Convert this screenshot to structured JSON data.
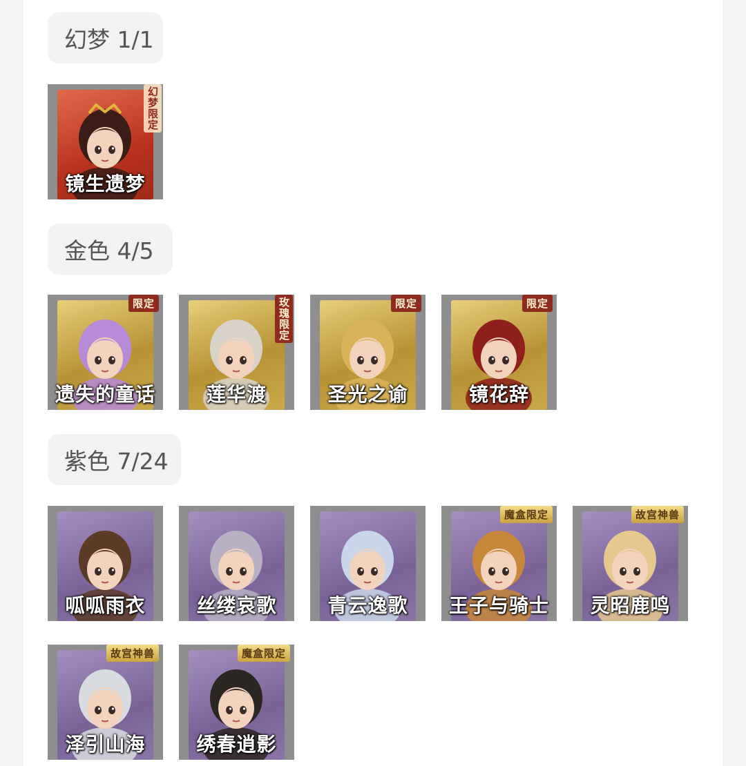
{
  "sections": [
    {
      "title": "幻梦 1/1",
      "tier": "dream",
      "items": [
        {
          "name": "镜生遗梦",
          "badge": "幻梦限定",
          "hair": "#3a1d16"
        }
      ]
    },
    {
      "title": "金色 4/5",
      "tier": "gold",
      "items": [
        {
          "name": "遗失的童话",
          "badge": "限定",
          "hair": "#b58ad6"
        },
        {
          "name": "莲华渡",
          "badge": "玫瑰限定",
          "hair": "#d9d2c8"
        },
        {
          "name": "圣光之谕",
          "badge": "限定",
          "hair": "#d9b25a"
        },
        {
          "name": "镜花辞",
          "badge": "限定",
          "hair": "#8e1f1c"
        }
      ]
    },
    {
      "title": "紫色 7/24",
      "tier": "purple",
      "items": [
        {
          "name": "呱呱雨衣",
          "badge": "",
          "hair": "#5a3b26"
        },
        {
          "name": "丝缕哀歌",
          "badge": "",
          "hair": "#b9b0c4"
        },
        {
          "name": "青云逸歌",
          "badge": "",
          "hair": "#c9d6ea"
        },
        {
          "name": "王子与骑士",
          "badge": "魔盒限定",
          "hair": "#c8873a"
        },
        {
          "name": "灵昭鹿鸣",
          "badge": "故宫神兽",
          "hair": "#e5c88f"
        },
        {
          "name": "泽引山海",
          "badge": "故宫神兽",
          "hair": "#d8dce0"
        },
        {
          "name": "绣春逍影",
          "badge": "魔盒限定",
          "hair": "#2c2622"
        }
      ]
    }
  ],
  "colors": {
    "dream_frame": "#c8472e",
    "gold_frame": "#c9a94a",
    "purple_frame": "#8b75a6",
    "card_bg": "#8e8e8e",
    "badge_red": "#8f2a1e"
  }
}
